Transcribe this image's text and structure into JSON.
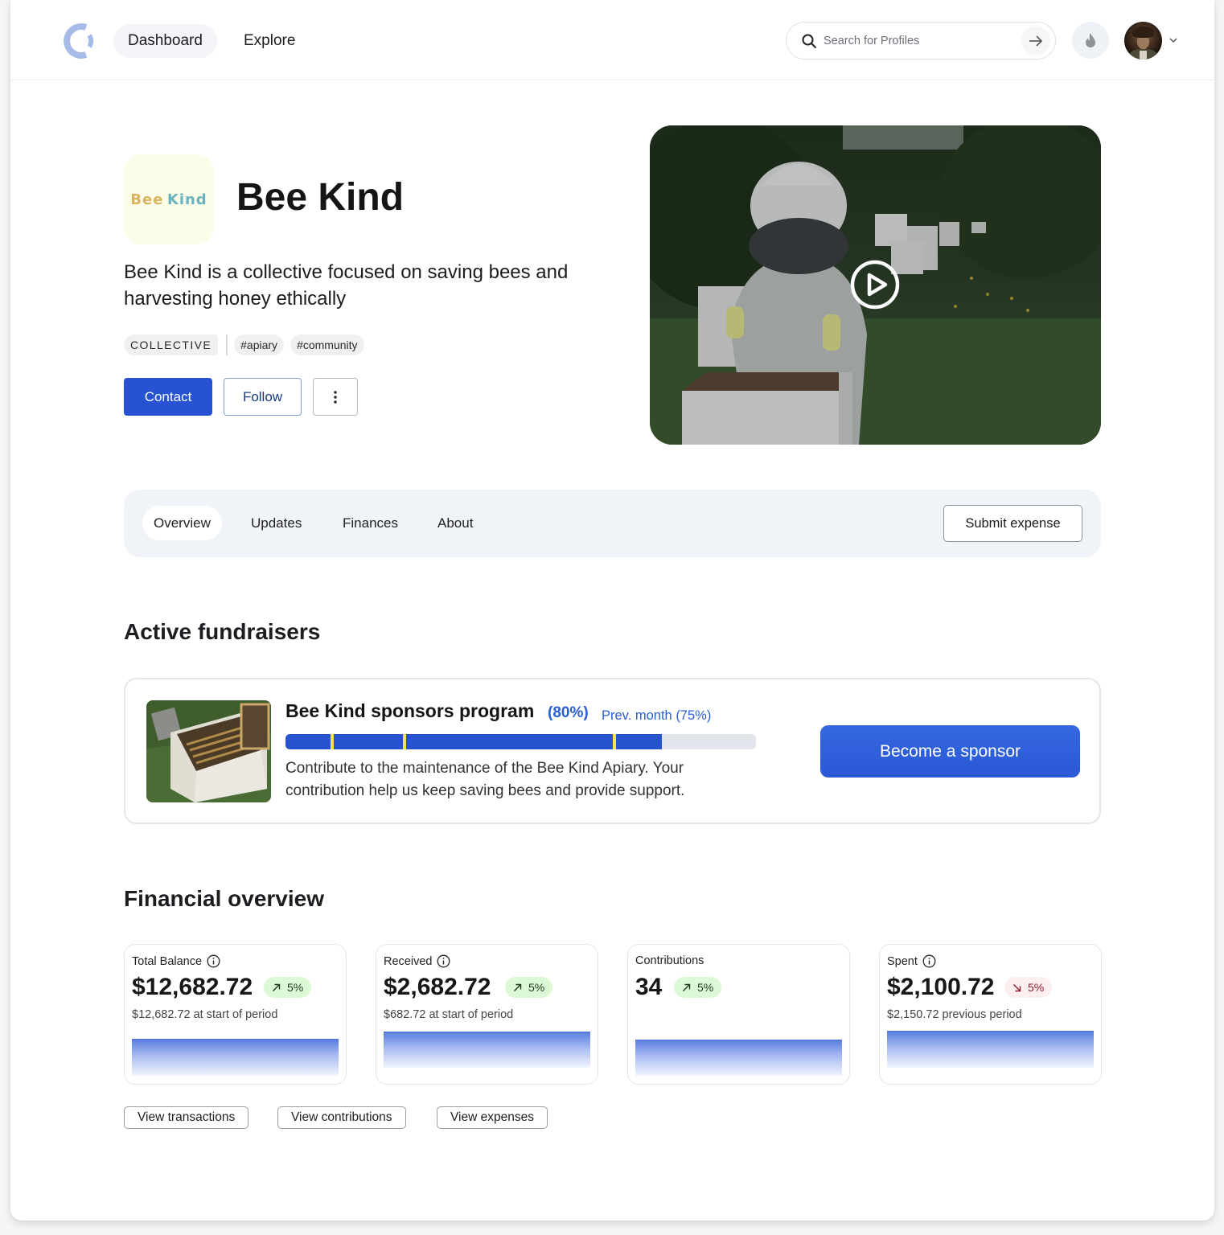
{
  "nav": {
    "logo": "circle-logo",
    "items": [
      {
        "label": "Dashboard",
        "active": true
      },
      {
        "label": "Explore",
        "active": false
      }
    ],
    "search": {
      "placeholder": "Search for Profiles",
      "value": ""
    },
    "notification_icon": "flame-icon",
    "user_menu_icon": "chevron-down-icon"
  },
  "profile": {
    "logo_text": [
      "Bee",
      "Kind"
    ],
    "name": "Bee Kind",
    "description": "Bee Kind is a collective focused on saving bees and harvesting honey ethically",
    "type_tag": "COLLECTIVE",
    "tags": [
      "#apiary",
      "#community"
    ],
    "actions": {
      "contact": "Contact",
      "follow": "Follow",
      "more_icon": "more-vertical-icon"
    },
    "video": {
      "play_icon": "play-icon"
    }
  },
  "tabs": {
    "items": [
      {
        "label": "Overview",
        "active": true
      },
      {
        "label": "Updates",
        "active": false
      },
      {
        "label": "Finances",
        "active": false
      },
      {
        "label": "About",
        "active": false
      }
    ],
    "submit_expense": "Submit expense"
  },
  "fundraisers": {
    "title": "Active fundraisers",
    "items": [
      {
        "title": "Bee Kind sponsors program",
        "percent_label": "(80%)",
        "prev_label": "Prev. month (75%)",
        "progress_percent": 80,
        "milestone_markers_percent": [
          9.6,
          25,
          69.5
        ],
        "description": "Contribute to the maintenance of the Bee Kind Apiary. Your contribution help us keep saving bees and provide support.",
        "cta": "Become a sponsor",
        "colors": {
          "fill": "#2753cf",
          "marker": "#f5e54a",
          "track": "#e2e6ec"
        }
      }
    ]
  },
  "financial": {
    "title": "Financial overview",
    "cards": [
      {
        "label": "Total Balance",
        "info": true,
        "value": "$12,682.72",
        "change": "5%",
        "direction": "up",
        "sub": "$12,682.72 at start of period"
      },
      {
        "label": "Received",
        "info": true,
        "value": "$2,682.72",
        "change": "5%",
        "direction": "up",
        "sub": "$682.72 at start of period"
      },
      {
        "label": "Contributions",
        "info": false,
        "value": "34",
        "change": "5%",
        "direction": "up",
        "sub": ""
      },
      {
        "label": "Spent",
        "info": true,
        "value": "$2,100.72",
        "change": "5%",
        "direction": "down",
        "sub": "$2,150.72 previous period"
      }
    ],
    "links": [
      "View transactions",
      "View contributions",
      "View expenses"
    ],
    "colors": {
      "up_bg": "#dcf8d4",
      "down_bg": "#fdeef0",
      "accent": "#2753d3"
    }
  }
}
